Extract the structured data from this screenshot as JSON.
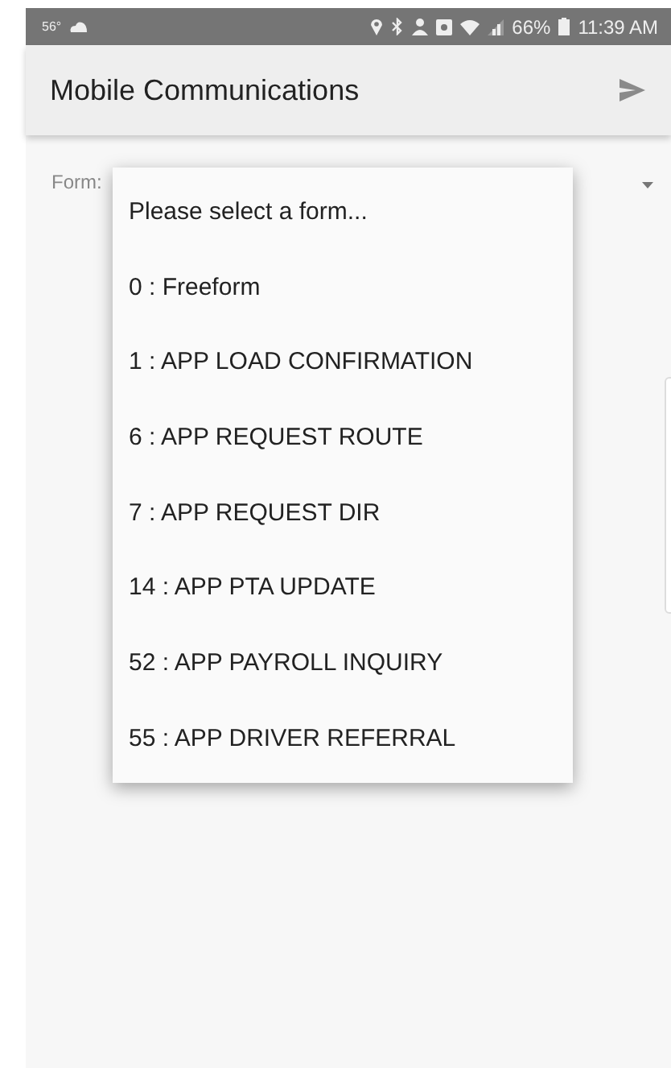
{
  "status_bar": {
    "temperature": "56°",
    "battery": "66%",
    "time": "11:39 AM"
  },
  "app_bar": {
    "title": "Mobile Communications"
  },
  "form_field": {
    "label": "Form:"
  },
  "dropdown": {
    "items": [
      {
        "label": "Please select a form..."
      },
      {
        "label": "0 : Freeform"
      },
      {
        "label": "1 : APP LOAD CONFIRMATION"
      },
      {
        "label": "6 : APP REQUEST ROUTE"
      },
      {
        "label": "7 : APP REQUEST DIR"
      },
      {
        "label": "14 : APP PTA UPDATE"
      },
      {
        "label": "52 : APP PAYROLL INQUIRY"
      },
      {
        "label": "55 : APP DRIVER REFERRAL"
      }
    ]
  }
}
